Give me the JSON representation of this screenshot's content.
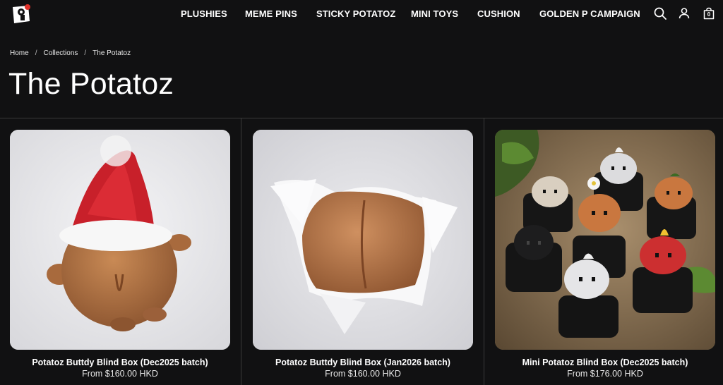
{
  "nav": {
    "items": [
      "PLUSHIES",
      "MEME PINS",
      "STICKY POTATOZ",
      "MINI TOYS",
      "CUSHION",
      "GOLDEN P CAMPAIGN"
    ],
    "cart_count": "0"
  },
  "breadcrumb": [
    "Home",
    "/",
    "Collections",
    "/",
    "The Potatoz"
  ],
  "page_title": "The Potatoz",
  "products": [
    {
      "title": "Potatoz Buttdy Blind Box (Dec2025 batch)",
      "price": "From $160.00 HKD"
    },
    {
      "title": "Potatoz Buttdy Blind Box (Jan2026 batch)",
      "price": "From $160.00 HKD"
    },
    {
      "title": "Mini Potatoz Blind Box (Dec2025 batch)",
      "price": "From $176.00 HKD"
    }
  ],
  "colors": {
    "background": "#111112",
    "text": "#ffffff",
    "divider": "#3a3a3a",
    "logo_accent": "#e0322b"
  }
}
